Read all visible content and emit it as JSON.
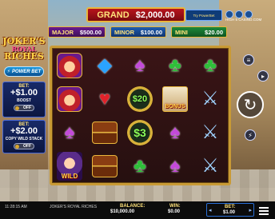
{
  "jackpots": {
    "grand": {
      "label": "GRAND",
      "value": "$2,000.00"
    },
    "major": {
      "label": "MAJOR",
      "value": "$500.00"
    },
    "minor": {
      "label": "MINOR",
      "value": "$100.00"
    },
    "mini": {
      "label": "MINI",
      "value": "$20.00"
    }
  },
  "header": {
    "promo_text": "Try PowerBet",
    "casino_logo": "HIGH 5 CASINO.COM",
    "icons": [
      "info-icon",
      "sound-icon",
      "settings-icon"
    ]
  },
  "logo": {
    "line1": "JOKER'S",
    "line2": "ROYAL",
    "line3": "RICHES"
  },
  "powerbet": {
    "label": "POWER BET"
  },
  "boost": {
    "bet_label": "BET:",
    "amount": "+$1.00",
    "name": "BOOST",
    "toggle": "OFF"
  },
  "copy_wild": {
    "bet_label": "BET:",
    "amount": "+$2.00",
    "name": "COPY WILD STACK",
    "toggle": "OFF"
  },
  "reels": [
    [
      "jester-symbol",
      "diamond-symbol",
      "spade-symbol",
      "club-symbol",
      "club-symbol"
    ],
    [
      "jester-symbol",
      "heart-symbol",
      "coin-symbol",
      "bonus-symbol",
      "scepter-symbol"
    ],
    [
      "spade-symbol",
      "chest-symbol",
      "coin-symbol",
      "spade-symbol",
      "scepter-symbol"
    ],
    [
      "wild-symbol",
      "chest-symbol",
      "club-symbol",
      "spade-symbol",
      "scepter-symbol"
    ]
  ],
  "symbols": {
    "coin_top": "$20",
    "coin_mid": "$3",
    "bonus_label": "BONUS",
    "wild_label": "WILD"
  },
  "bottom_bar": {
    "time": "11:28:15 AM",
    "game_name": "JOKER'S ROYAL RICHES",
    "balance_label": "BALANCE:",
    "balance_value": "$10,000.00",
    "win_label": "WIN:",
    "win_value": "$0.00",
    "bet_label": "BET:",
    "bet_value": "$1.00"
  }
}
